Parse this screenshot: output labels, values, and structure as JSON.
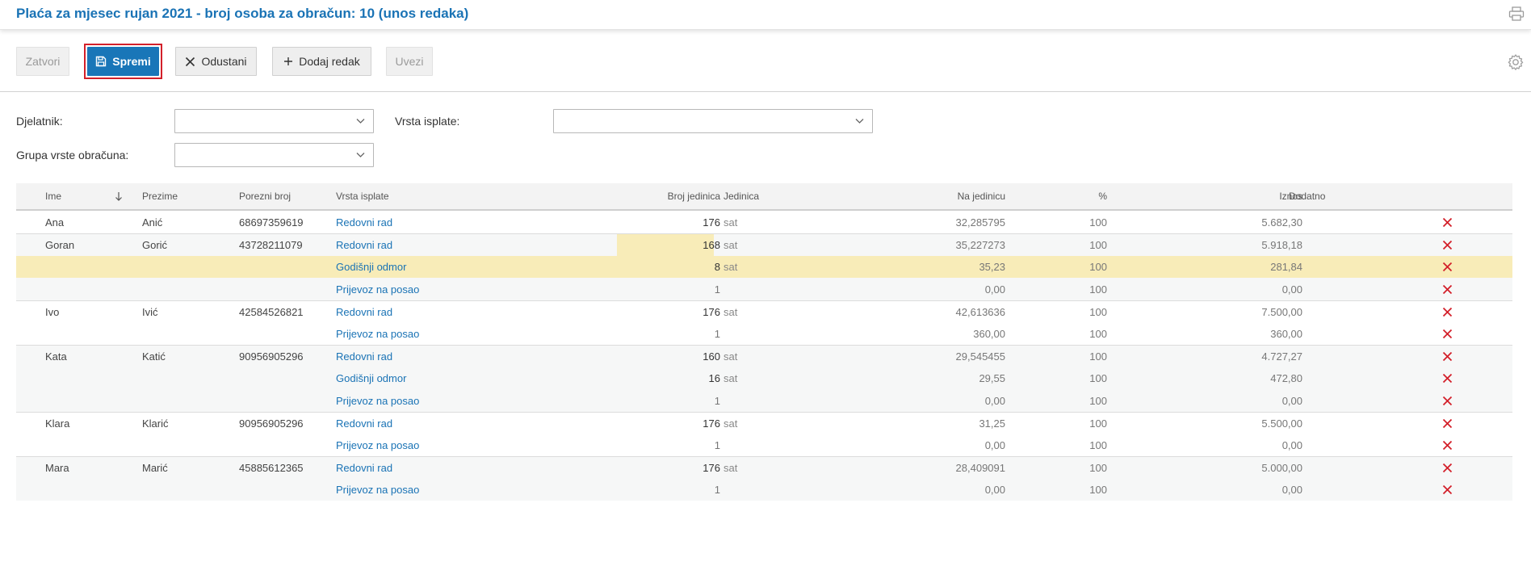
{
  "header": {
    "title": "Plaća za mjesec rujan 2021 - broj osoba za obračun: 10 (unos redaka)"
  },
  "toolbar": {
    "close": "Zatvori",
    "save": "Spremi",
    "cancel": "Odustani",
    "add_row": "Dodaj redak",
    "import": "Uvezi"
  },
  "filters": {
    "employee_label": "Djelatnik:",
    "employee_value": "",
    "payment_type_label": "Vrsta isplate:",
    "payment_type_value": "",
    "group_label": "Grupa vrste obračuna:",
    "group_value": ""
  },
  "table": {
    "columns": [
      "Ime",
      "Prezime",
      "Porezni broj",
      "Vrsta isplate",
      "Broj jedinica",
      "Jedinica",
      "Na jedinicu",
      "%",
      "Iznos",
      "Dodatno"
    ],
    "rows": [
      {
        "ime": "Ana",
        "prezime": "Anić",
        "porezni": "68697359619",
        "vrsta": "Redovni rad",
        "broj": "176",
        "jedinica": "sat",
        "na_jedinicu": "32,285795",
        "pct": "100",
        "iznos": "5.682,30",
        "dodatno": ""
      },
      {
        "ime": "Goran",
        "prezime": "Gorić",
        "porezni": "43728211079",
        "vrsta": "Redovni rad",
        "broj": "168",
        "jedinica": "sat",
        "na_jedinicu": "35,227273",
        "pct": "100",
        "iznos": "5.918,18",
        "dodatno": ""
      },
      {
        "ime": "",
        "prezime": "",
        "porezni": "",
        "vrsta": "Godišnji odmor",
        "broj": "8",
        "jedinica": "sat",
        "na_jedinicu": "35,23",
        "pct": "100",
        "iznos": "281,84",
        "dodatno": ""
      },
      {
        "ime": "",
        "prezime": "",
        "porezni": "",
        "vrsta": "Prijevoz na posao",
        "broj": "1",
        "jedinica": "",
        "na_jedinicu": "0,00",
        "pct": "100",
        "iznos": "0,00",
        "dodatno": ""
      },
      {
        "ime": "Ivo",
        "prezime": "Ivić",
        "porezni": "42584526821",
        "vrsta": "Redovni rad",
        "broj": "176",
        "jedinica": "sat",
        "na_jedinicu": "42,613636",
        "pct": "100",
        "iznos": "7.500,00",
        "dodatno": ""
      },
      {
        "ime": "",
        "prezime": "",
        "porezni": "",
        "vrsta": "Prijevoz na posao",
        "broj": "1",
        "jedinica": "",
        "na_jedinicu": "360,00",
        "pct": "100",
        "iznos": "360,00",
        "dodatno": ""
      },
      {
        "ime": "Kata",
        "prezime": "Katić",
        "porezni": "90956905296",
        "vrsta": "Redovni rad",
        "broj": "160",
        "jedinica": "sat",
        "na_jedinicu": "29,545455",
        "pct": "100",
        "iznos": "4.727,27",
        "dodatno": ""
      },
      {
        "ime": "",
        "prezime": "",
        "porezni": "",
        "vrsta": "Godišnji odmor",
        "broj": "16",
        "jedinica": "sat",
        "na_jedinicu": "29,55",
        "pct": "100",
        "iznos": "472,80",
        "dodatno": ""
      },
      {
        "ime": "",
        "prezime": "",
        "porezni": "",
        "vrsta": "Prijevoz na posao",
        "broj": "1",
        "jedinica": "",
        "na_jedinicu": "0,00",
        "pct": "100",
        "iznos": "0,00",
        "dodatno": ""
      },
      {
        "ime": "Klara",
        "prezime": "Klarić",
        "porezni": "90956905296",
        "vrsta": "Redovni rad",
        "broj": "176",
        "jedinica": "sat",
        "na_jedinicu": "31,25",
        "pct": "100",
        "iznos": "5.500,00",
        "dodatno": ""
      },
      {
        "ime": "",
        "prezime": "",
        "porezni": "",
        "vrsta": "Prijevoz na posao",
        "broj": "1",
        "jedinica": "",
        "na_jedinicu": "0,00",
        "pct": "100",
        "iznos": "0,00",
        "dodatno": ""
      },
      {
        "ime": "Mara",
        "prezime": "Marić",
        "porezni": "45885612365",
        "vrsta": "Redovni rad",
        "broj": "176",
        "jedinica": "sat",
        "na_jedinicu": "28,409091",
        "pct": "100",
        "iznos": "5.000,00",
        "dodatno": ""
      },
      {
        "ime": "",
        "prezime": "",
        "porezni": "",
        "vrsta": "Prijevoz na posao",
        "broj": "1",
        "jedinica": "",
        "na_jedinicu": "0,00",
        "pct": "100",
        "iznos": "0,00",
        "dodatno": ""
      }
    ]
  },
  "colors": {
    "accent": "#1a73b5",
    "primary_button": "#1976b8",
    "highlight_frame": "#d3202a",
    "selected_row": "#f8ecb8",
    "delete": "#d3202a"
  },
  "icons": {
    "print": "print-icon",
    "save": "floppy-disk-icon",
    "cancel": "close-x-icon",
    "add": "plus-icon",
    "settings": "gear-icon",
    "sort": "arrow-down-icon",
    "dropdown": "chevron-down-icon",
    "delete": "delete-x-icon"
  }
}
